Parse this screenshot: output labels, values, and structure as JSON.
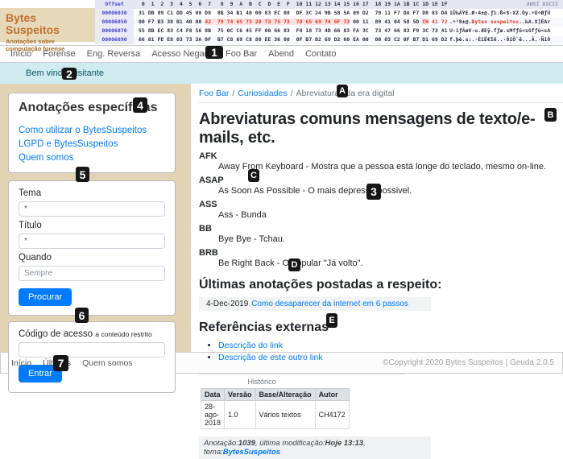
{
  "header": {
    "logo_title": "Bytes Suspeitos",
    "logo_subtitle": "Anotações sobre computação forense",
    "hexdump": {
      "offset_label": "Offset",
      "columns": " 0  1  2  3  4  5  6  7   8  9  A  B  C  D  E  F  10 11 12 13 14 15 16 17  18 19 1A 1B 1C 1D 1E 1F",
      "ansi_label": "ANSI ASCII",
      "rows": [
        {
          "offset": "00006030",
          "pre": "31 DB 89 C1 DD 45 08 D8  8B 34 B1 40 00 83 EC 08  DF 3C 24 9B 58 5A 09 D2  79 11 F7 DA F7 D8 83 DA",
          "ascii_pre": "1Û‰ÁÝE.Ø‹4±@.ƒì.ß<$›XZ.Òy.÷Ú÷ØƒÚ"
        },
        {
          "offset": "00006050",
          "pre": "00 F7 B3 38 B1 40 00 ",
          "hl": "42  79 74 65 73 20 73 75 73  70 65 69 74 6F 73",
          "mid": " 00 11  89 41 04 58 5D ",
          "hl2": "CH",
          "post": " 41 72",
          "ascii_pre": ".÷³8±@.",
          "ascii_hl": "Bytes suspeitos",
          "ascii_post": "..‰A.X]ÉAr"
        },
        {
          "offset": "00006070",
          "pre": "55 8B EC 83 C4 F8 56 8B  75 0C C6 45 FF 00 66 83  F8 18 73 4D 66 83 FA 3C  73 47 66 83 F9 3C 73 41",
          "ascii_pre": "U‹ìƒÄøV‹u.ÆEÿ.fƒø.sMfƒú<sGfƒù<sA"
        },
        {
          "offset": "00006090",
          "pre": "66 81 FE E8 03 73 3A 0F  B7 C8 69 C8 80 EE 36 00  0F B7 D2 69 D2 60 EA 00  00 03 C2 0F B7 D1 69 D2",
          "ascii_pre": "f.þè.s:.·ÈiÈ€î6..·ÒiÒ`ê...Â.·ÑiÒ"
        }
      ]
    }
  },
  "nav": {
    "items": [
      "Início",
      "Forense",
      "Eng. Reversa",
      "Acesso Negado",
      "Foo Bar",
      "Abend",
      "Contato"
    ]
  },
  "welcome": {
    "text": "Bem vindo Visitante"
  },
  "sidebar": {
    "notes_title": "Anotações específicas",
    "links": [
      "Como utilizar o BytesSuspeitos",
      "LGPD e BytesSuspeitos",
      "Quem somos"
    ],
    "form": {
      "tema_label": "Tema",
      "tema_value": "*",
      "titulo_label": "Título",
      "titulo_value": "*",
      "quando_label": "Quando",
      "quando_placeholder": "Sempre",
      "search_button": "Procurar"
    },
    "access": {
      "label": "Código de acesso",
      "label_small": "a conteúdo restrito",
      "button": "Entrar"
    }
  },
  "main": {
    "breadcrumb": {
      "items": [
        "Foo Bar",
        "Curiosidades"
      ],
      "current": "Abreviaturas da era digital",
      "separator": "/"
    },
    "title": "Abreviaturas comuns mensagens de texto/e-mails, etc.",
    "abbreviations": [
      {
        "term": "AFK",
        "def": "Away From Keyboard - Mostra que a pessoa está longe do teclado, mesmo on-line."
      },
      {
        "term": "ASAP",
        "def": "As Soon As Possible - O mais depressa possivel."
      },
      {
        "term": "ASS",
        "def": "Ass - Bunda"
      },
      {
        "term": "BB",
        "def": "Bye Bye - Tchau."
      },
      {
        "term": "BRB",
        "def": "Be Right Back - O popular \"Já volto\"."
      }
    ],
    "latest": {
      "heading": "Últimas anotações postadas a respeito:",
      "date": "4-Dec-2019",
      "link": "Como desaparecer da internet em 6 passos"
    },
    "references": {
      "heading": "Referências externas",
      "links": [
        "Descrição do link",
        "Descrição de este outro link"
      ]
    },
    "history": {
      "caption": "Histórico",
      "headers": [
        "Data",
        "Versão",
        "Base/Alteração",
        "Autor"
      ],
      "rows": [
        [
          "28-ago-2018",
          "1.0",
          "Vários textos",
          "CH4172"
        ]
      ]
    },
    "annotation": {
      "label1": "Anotação:",
      "value1": "1039",
      "label2": ", última modificação:",
      "value2": "Hoje 13:13",
      "label3": ", tema:",
      "value3": "BytesSuspeitos"
    }
  },
  "footer": {
    "links": [
      "Início",
      "Últimos",
      "Quem somos"
    ],
    "copyright": "©Copyright 2020 Bytes Suspeitos | Geuda 2.0.5"
  },
  "overlay": {
    "badges": [
      "1",
      "2",
      "3",
      "4",
      "5",
      "6",
      "7",
      "A",
      "B",
      "C",
      "D",
      "E"
    ]
  },
  "colors": {
    "accent_blue": "#007bff",
    "brand_orange": "#c0712c",
    "hex_highlight_red": "#e2342b",
    "welcome_bg": "#d1ecf1",
    "welcome_text": "#0c5460",
    "sidebar_bg": "#e2d3b5",
    "offset_blue": "#4343cc",
    "badge_bg": "#161616"
  }
}
